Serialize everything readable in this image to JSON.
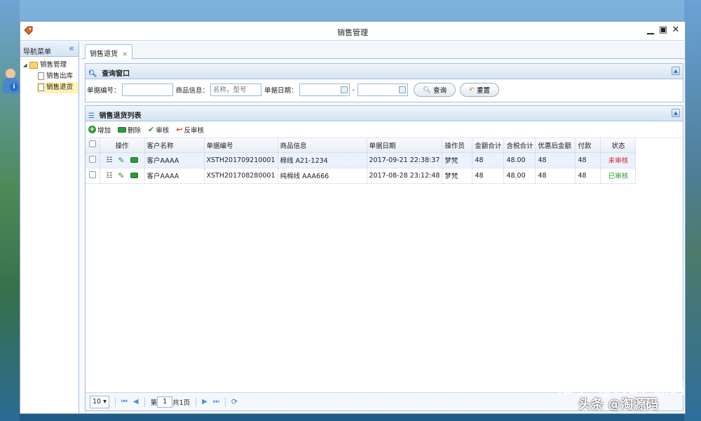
{
  "window": {
    "title": "销售管理"
  },
  "nav": {
    "header": "导航菜单",
    "root": "销售管理",
    "items": [
      "销售出库",
      "销售退货"
    ]
  },
  "tabs": [
    {
      "label": "销售退货",
      "close": "×"
    }
  ],
  "query": {
    "header": "查询窗口",
    "doc_no_label": "单据编号：",
    "doc_no_value": "",
    "goods_label": "商品信息：",
    "goods_placeholder": "名称，型号",
    "date_label": "单据日期：",
    "date_sep": "-",
    "search_btn": "查询",
    "reset_btn": "重置"
  },
  "list": {
    "header": "销售退货列表",
    "toolbar": {
      "add": "增加",
      "delete": "删除",
      "audit": "审核",
      "unaudit": "反审核"
    },
    "columns": [
      "操作",
      "客户名称",
      "单据编号",
      "商品信息",
      "单据日期",
      "操作员",
      "金额合计",
      "含税合计",
      "优惠后金额",
      "付款",
      "状态"
    ],
    "rows": [
      {
        "customer": "客户AAAA",
        "doc_no": "XSTH201709210001",
        "goods": "棉线 A21-1234",
        "date": "2017-09-21 22:38:37",
        "operator": "梦梵",
        "amount": "48",
        "tax_total": "48.00",
        "discounted": "48",
        "paid": "48",
        "status": "未审核"
      },
      {
        "customer": "客户AAAA",
        "doc_no": "XSTH201708280001",
        "goods": "纯棉线 AAA666",
        "date": "2017-08-28 23:12:48",
        "operator": "梦梵",
        "amount": "48",
        "tax_total": "48.00",
        "discounted": "48",
        "paid": "48",
        "status": "已审核"
      }
    ]
  },
  "pager": {
    "page_size": "10 ▾",
    "page_prefix": "第",
    "page_value": "1",
    "page_suffix": "共1页"
  },
  "watermark": {
    "line1": "知乎 @ASP源码",
    "line2": "头条 @淘源码"
  },
  "colors": {
    "unaudited": "#dd2222",
    "audited": "#2a9a2a",
    "accent": "#3b70b0"
  }
}
